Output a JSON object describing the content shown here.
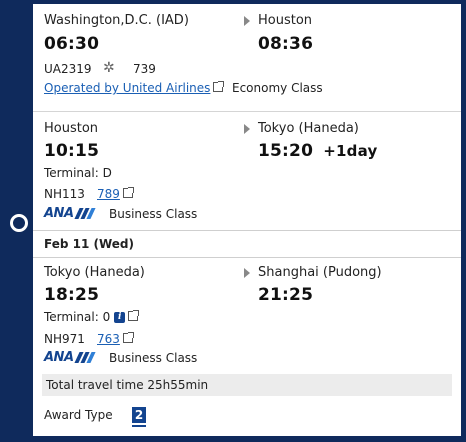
{
  "segments": [
    {
      "from_city": "Washington,D.C. (IAD)",
      "dep_time": "06:30",
      "to_city": "Houston",
      "arr_time": "08:36",
      "flight_no": "UA2319",
      "aircraft": "739",
      "operated_by": "Operated by United Airlines",
      "cabin": "Economy Class"
    },
    {
      "from_city": "Houston",
      "dep_time": "10:15",
      "to_city": "Tokyo (Haneda)",
      "arr_time": "15:20",
      "day_offset": "+1day",
      "terminal": "Terminal: D",
      "flight_no": "NH113",
      "aircraft": "789",
      "airline_logo": "ANA",
      "cabin": "Business Class"
    },
    {
      "from_city": "Tokyo (Haneda)",
      "dep_time": "18:25",
      "to_city": "Shanghai (Pudong)",
      "arr_time": "21:25",
      "terminal": "Terminal: 0",
      "flight_no": "NH971",
      "aircraft": "763",
      "airline_logo": "ANA",
      "cabin": "Business Class"
    }
  ],
  "date_divider": "Feb 11 (Wed)",
  "total_travel": "Total travel time 25h55min",
  "award": {
    "label": "Award Type",
    "value": "2"
  },
  "icons": {
    "info": "i",
    "timeline": "timeline-dot-icon",
    "star": "star-alliance-icon",
    "external": "external-link-icon"
  },
  "colors": {
    "frame": "#0f2a5c",
    "link": "#1a5fb4",
    "ana_blue": "#13448f"
  }
}
